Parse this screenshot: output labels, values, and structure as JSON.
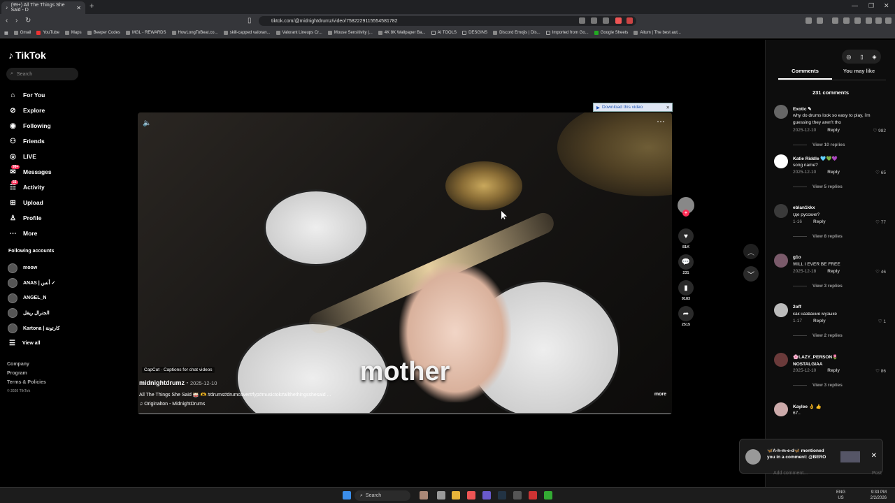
{
  "browser": {
    "tab_title": "(99+) All The Things She Said - D",
    "url": "tiktok.com/@midnightdrumz/video/7582229115554581782",
    "bookmarks": [
      "Gmail",
      "YouTube",
      "Maps",
      "Beeper Codes",
      "MGL - REWARDS",
      "HowLongToBeat.co...",
      "skill-capped valoran...",
      "Valorant Lineups Cr...",
      "Mouse Sensitivity |...",
      "4K 8K Wallpaper Ba...",
      "AI TOOLS",
      "DESGINS",
      "Discord Emojis | Dis...",
      "Imported from Go...",
      "Google Sheets",
      "Aitum | The best aut..."
    ]
  },
  "sidebar": {
    "logo": "TikTok",
    "search_placeholder": "Search",
    "nav": [
      {
        "label": "For You",
        "icon": "home-icon"
      },
      {
        "label": "Explore",
        "icon": "compass-icon"
      },
      {
        "label": "Following",
        "icon": "following-icon"
      },
      {
        "label": "Friends",
        "icon": "friends-icon"
      },
      {
        "label": "LIVE",
        "icon": "live-icon"
      },
      {
        "label": "Messages",
        "icon": "messages-icon",
        "badge": "99+"
      },
      {
        "label": "Activity",
        "icon": "activity-icon",
        "badge": "56"
      },
      {
        "label": "Upload",
        "icon": "upload-icon"
      },
      {
        "label": "Profile",
        "icon": "profile-icon"
      },
      {
        "label": "More",
        "icon": "more-icon"
      }
    ],
    "following_title": "Following accounts",
    "following": [
      "moow",
      "ANAS | أنس ✓",
      "ANGEL_N",
      "الجنرال ريفل",
      "Kartona | كارتونة",
      "View all"
    ],
    "footer": [
      "Company",
      "Program",
      "Terms & Policies"
    ],
    "copyright": "© 2026 TikTok"
  },
  "video": {
    "download_banner": "Download this video",
    "caption_word": "mother",
    "capcut": "CapCut · Captions for chat videos",
    "author": "midnightdrumz",
    "date": "2025-12-10",
    "description": "All The Things She Said 🥁 🫶 #drums#drumcover#fyp#musictok#allthethingsshesaid ...",
    "sound": "Originalton - MidnightDrums",
    "more": "more",
    "likes": "81K",
    "comments": "231",
    "saves": "9183",
    "shares": "2515"
  },
  "panel": {
    "tabs": [
      "Comments",
      "You may like"
    ],
    "count": "231 comments",
    "comments": [
      {
        "name": "Exotic ✎",
        "text": "why do drums look so easy to play, i'm guessing they aren't tho",
        "date": "2025-12-10",
        "reply": "Reply",
        "likes": "982",
        "replies": "View 10 replies"
      },
      {
        "name": "Katie Riddle 🩵💚💜",
        "text": "song name?",
        "date": "2025-12-10",
        "reply": "Reply",
        "likes": "65",
        "replies": "View 5 replies"
      },
      {
        "name": "eblan1kkx",
        "text": "где русские?",
        "date": "1-16",
        "reply": "Reply",
        "likes": "77",
        "replies": "View 8 replies"
      },
      {
        "name": "g1o",
        "text": "WILL I EVER BE FREE",
        "date": "2025-12-18",
        "reply": "Reply",
        "likes": "46",
        "replies": "View 3 replies"
      },
      {
        "name": "2off",
        "text": "как название музыке",
        "date": "1-17",
        "reply": "Reply",
        "likes": "1",
        "replies": "View 2 replies"
      },
      {
        "name": "🌸LAZY_PERSON🌷NOSTALGIAA",
        "text": "",
        "date": "2025-12-10",
        "reply": "Reply",
        "likes": "86",
        "replies": "View 3 replies"
      },
      {
        "name": "Kaylee 👌 👍",
        "text": "67..",
        "date": "",
        "reply": "",
        "likes": "",
        "replies": ""
      }
    ],
    "notification": "🦋A-h-m-e-d🦋 mentioned you in a comment: @BERO",
    "add_comment_placeholder": "Add comment...",
    "post": "Post"
  },
  "taskbar": {
    "search": "Search",
    "lang1": "ENG",
    "lang2": "US",
    "time": "9:33 PM",
    "date": "2/2/2026"
  }
}
